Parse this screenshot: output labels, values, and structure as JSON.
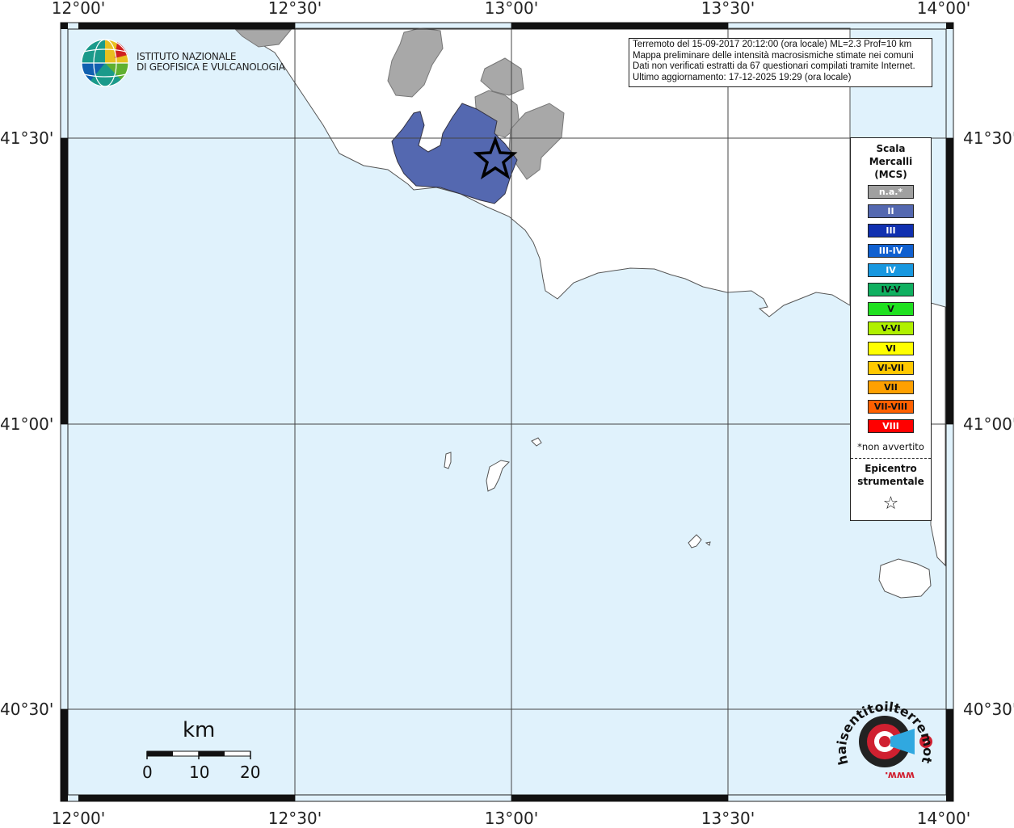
{
  "axes": {
    "lon_labels": [
      "12°00'",
      "12°30'",
      "13°00'",
      "13°30'",
      "14°00'"
    ],
    "lat_labels": [
      "41°30'",
      "41°00'",
      "40°30'"
    ]
  },
  "institute": {
    "line1": "ISTITUTO NAZIONALE",
    "line2": "DI GEOFISICA E VULCANOLOGIA"
  },
  "info": {
    "line1": "Terremoto del 15-09-2017 20:12:00 (ora locale) ML=2.3 Prof=10 km",
    "line2": "Mappa preliminare delle intensità macrosismiche stimate nei comuni",
    "line3": "Dati non verificati estratti da 67 questionari compilati tramite Internet.",
    "line4": "Ultimo aggiornamento: 17-12-2025 19:29 (ora locale)"
  },
  "legend": {
    "title1": "Scala",
    "title2": "Mercalli",
    "title3": "(MCS)",
    "items": [
      {
        "label": "n.a.*",
        "color": "#a0a0a0",
        "text_color": "#ffffff"
      },
      {
        "label": "II",
        "color": "#5468b0",
        "text_color": "#ffffff"
      },
      {
        "label": "III",
        "color": "#1030b0",
        "text_color": "#ffffff"
      },
      {
        "label": "III-IV",
        "color": "#1060d0",
        "text_color": "#ffffff"
      },
      {
        "label": "IV",
        "color": "#1898e0",
        "text_color": "#ffffff"
      },
      {
        "label": "IV-V",
        "color": "#10b060",
        "text_color": "#111111"
      },
      {
        "label": "V",
        "color": "#20e020",
        "text_color": "#111111"
      },
      {
        "label": "V-VI",
        "color": "#b0f000",
        "text_color": "#111111"
      },
      {
        "label": "VI",
        "color": "#ffff00",
        "text_color": "#111111"
      },
      {
        "label": "VI-VII",
        "color": "#ffc800",
        "text_color": "#111111"
      },
      {
        "label": "VII",
        "color": "#ffa000",
        "text_color": "#111111"
      },
      {
        "label": "VII-VIII",
        "color": "#ff6000",
        "text_color": "#111111"
      },
      {
        "label": "VIII",
        "color": "#ff0000",
        "text_color": "#ffffff"
      }
    ],
    "note": "*non avvertito",
    "epicenter1": "Epicentro",
    "epicenter2": "strumentale",
    "star": "☆"
  },
  "scale_bar": {
    "unit": "km",
    "ticks": [
      "0",
      "10",
      "20"
    ]
  },
  "brand": {
    "text": "haisentitoilterremoto.it",
    "prefix": "www."
  },
  "colors": {
    "sea": "#e0f2fc",
    "land": "#ffffff",
    "intensity_II": "#5468b0",
    "not_felt": "#a0a0a0"
  }
}
